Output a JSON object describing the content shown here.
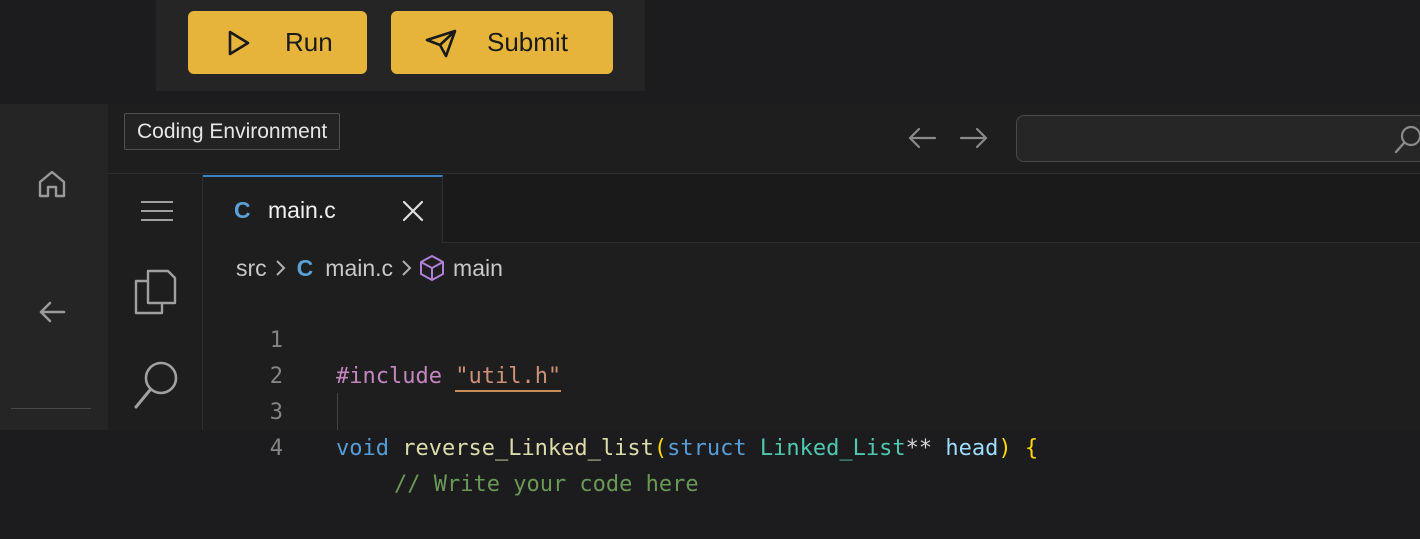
{
  "toolbar": {
    "run_label": "Run",
    "submit_label": "Submit",
    "accent_color": "#e6b43a"
  },
  "title": {
    "tooltip": "Coding Environment"
  },
  "search": {
    "value": "",
    "icon": "search-icon"
  },
  "activity_bar": {
    "icons": [
      "home-icon",
      "back-arrow-icon"
    ]
  },
  "side_panel": {
    "icons": [
      "menu-icon",
      "copy-files-icon",
      "search-icon"
    ]
  },
  "editor": {
    "tab": {
      "lang_glyph": "C",
      "filename": "main.c",
      "close_icon": "close-icon"
    },
    "breadcrumb": {
      "folder": "src",
      "lang_glyph": "C",
      "file": "main.c",
      "symbol": "main",
      "symbol_icon": "cube-icon"
    },
    "lines": [
      {
        "number": "1",
        "include": "#include",
        "space": " ",
        "path": "\"util.h\""
      },
      {
        "number": "2"
      },
      {
        "number": "3",
        "kw_void": "void",
        "fn_name": "reverse_Linked_list",
        "open_paren": "(",
        "kw_struct": "struct",
        "type_name": "Linked_List",
        "ptr": "**",
        "param": "head",
        "close_paren": ")",
        "brace": "{"
      },
      {
        "number": "4",
        "comment": "// Write your code here"
      }
    ]
  }
}
